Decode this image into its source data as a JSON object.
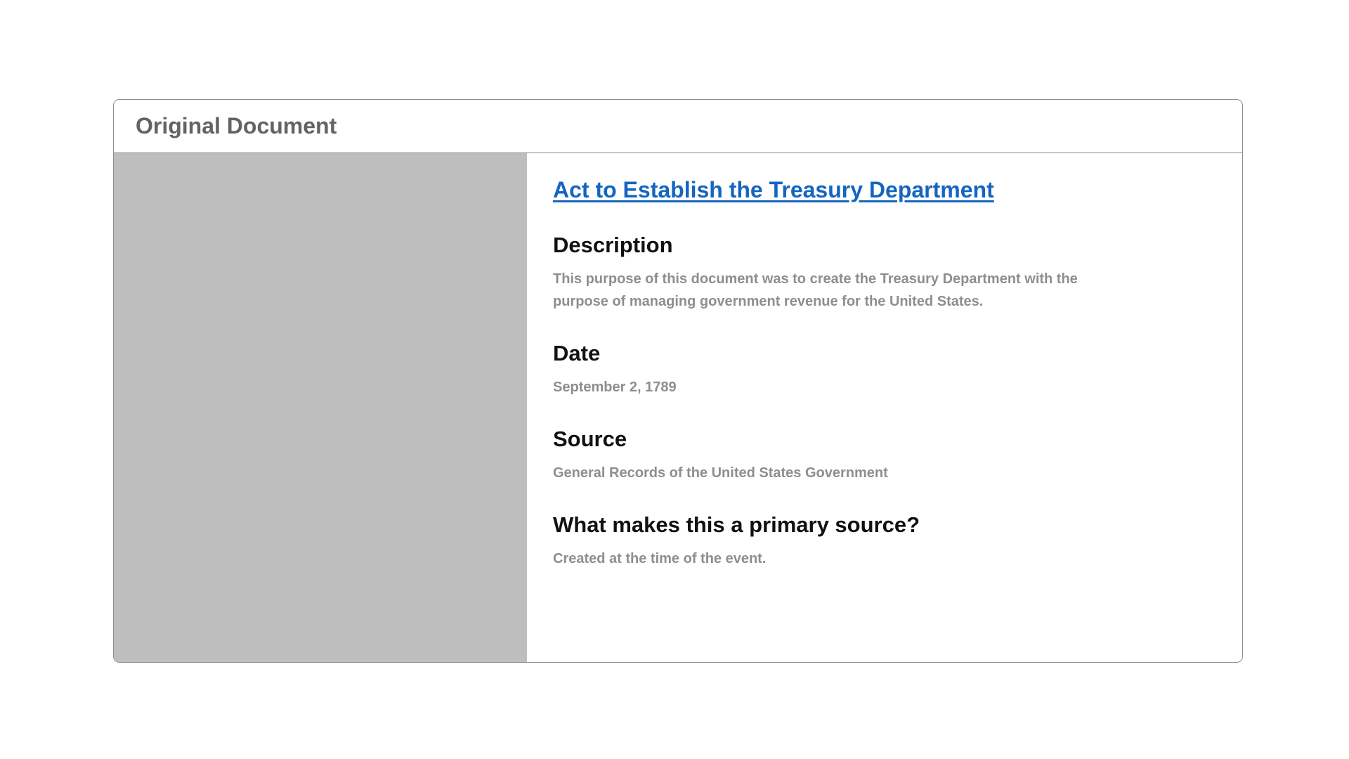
{
  "card": {
    "title": "Original Document"
  },
  "document": {
    "title": "Act to Establish the Treasury Department",
    "sections": [
      {
        "heading": "Description",
        "text": "This purpose of this document was to create the Treasury Department with the purpose of managing government revenue for the United States."
      },
      {
        "heading": "Date",
        "text": "September 2, 1789"
      },
      {
        "heading": "Source",
        "text": "General Records of the United States Government"
      },
      {
        "heading": "What makes this a primary source?",
        "text": "Created at the time of the event."
      }
    ]
  },
  "colors": {
    "link": "#1565c0",
    "heading": "#111111",
    "body_text": "#8e8e8e",
    "header_text": "#636363",
    "image_placeholder": "#bebebe",
    "border": "#8c8c8c"
  }
}
